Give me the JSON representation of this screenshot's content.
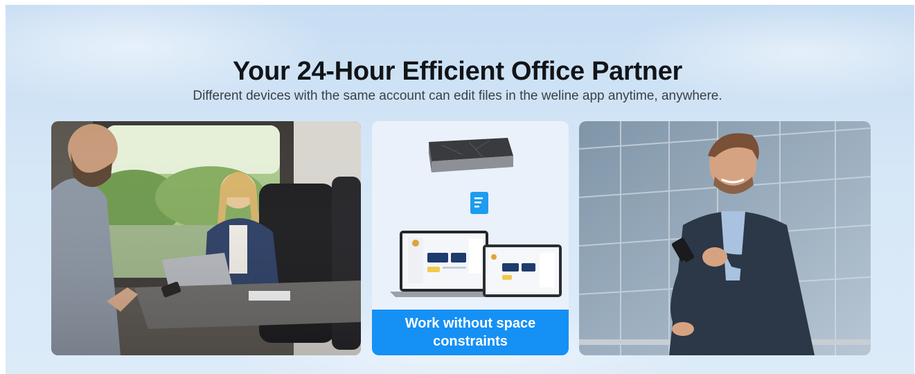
{
  "header": {
    "title": "Your 24-Hour Efficient Office Partner",
    "subtitle": "Different devices with the same account can edit files in the weline app anytime, anywhere."
  },
  "middle_panel": {
    "caption": "Work without space constraints"
  },
  "colors": {
    "caption_bg": "#1590f5",
    "background": "#d6e7f7",
    "title": "#111418"
  },
  "images": [
    {
      "name": "train-work-photo"
    },
    {
      "name": "nas-device-photo"
    },
    {
      "name": "phone-user-photo"
    }
  ]
}
